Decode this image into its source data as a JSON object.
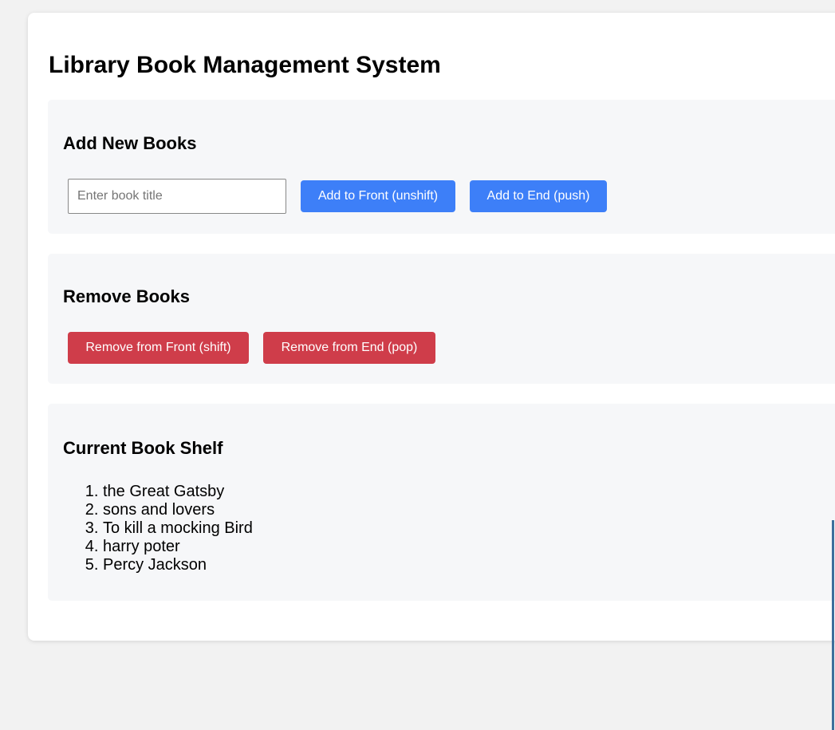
{
  "page": {
    "title": "Library Book Management System"
  },
  "add_section": {
    "title": "Add New Books",
    "input_placeholder": "Enter book title",
    "input_value": "",
    "front_button": "Add to Front (unshift)",
    "end_button": "Add to End (push)"
  },
  "remove_section": {
    "title": "Remove Books",
    "front_button": "Remove from Front (shift)",
    "end_button": "Remove from End (pop)"
  },
  "shelf_section": {
    "title": "Current Book Shelf",
    "books": [
      "the Great Gatsby",
      "sons and lovers",
      "To kill a mocking Bird",
      "harry poter",
      "Percy Jackson"
    ]
  },
  "colors": {
    "add_button": "#3d7ff8",
    "remove_button": "#cf3d4a",
    "section_background": "#f6f7f9",
    "page_background": "#f2f2f2"
  }
}
